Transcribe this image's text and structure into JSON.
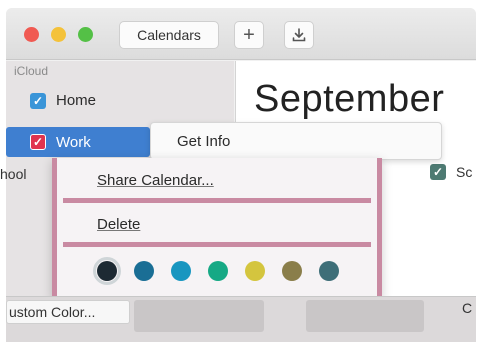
{
  "toolbar": {
    "calendars_label": "Calendars",
    "add_label": "+",
    "icons": {
      "add": "plus-icon",
      "export": "download-icon"
    }
  },
  "sidebar": {
    "section": "iCloud",
    "items": [
      {
        "label": "Home",
        "checked": true,
        "color": "#3a95d8",
        "selected": false
      },
      {
        "label": "Work",
        "checked": true,
        "color": "#e0344e",
        "selected": true
      },
      {
        "label": "hool",
        "checked": true,
        "color": "#4d7a72",
        "selected": false
      }
    ]
  },
  "main": {
    "month": "September",
    "right_label": "Sc"
  },
  "context_menu": {
    "get_info": "Get Info",
    "share": "Share Calendar...",
    "delete": "Delete",
    "colors": [
      "#1d2a33",
      "#1a6e95",
      "#1896c0",
      "#16a985",
      "#d4c53e",
      "#8a7e4a",
      "#3e6e78"
    ],
    "selected_color": "#1d2a33"
  },
  "bottom": {
    "custom_color": "ustom Color...",
    "right_clip": "C"
  },
  "colors": {
    "selection_blue": "#3f7fd0",
    "menu_border_pink": "#c98aa2"
  }
}
